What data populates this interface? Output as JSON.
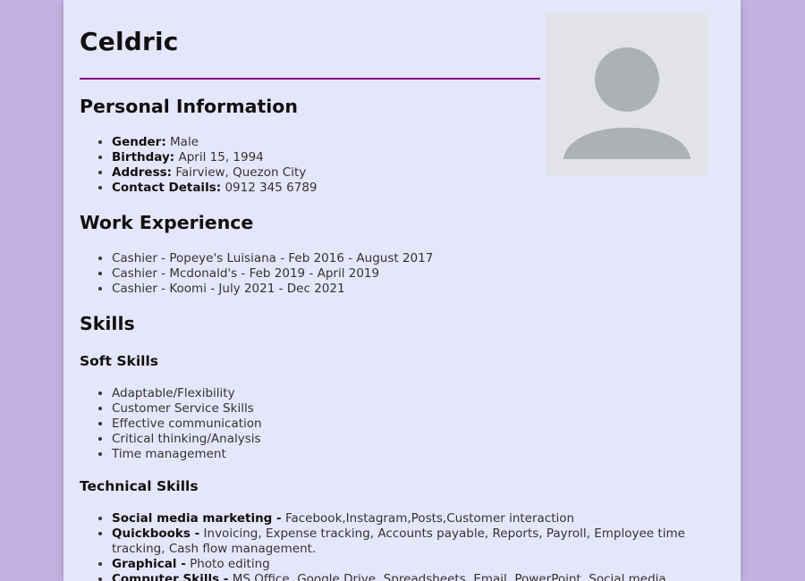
{
  "profile": {
    "name": "Celdric",
    "avatar_icon": "person-avatar-icon"
  },
  "personal": {
    "heading": "Personal Information",
    "items": [
      {
        "label": "Gender:",
        "value": "Male"
      },
      {
        "label": "Birthday:",
        "value": "April 15, 1994"
      },
      {
        "label": "Address:",
        "value": "Fairview, Quezon City"
      },
      {
        "label": "Contact Details:",
        "value": "0912 345 6789"
      }
    ]
  },
  "work": {
    "heading": "Work Experience",
    "items": [
      "Cashier - Popeye's Luisiana - Feb 2016 - August 2017",
      "Cashier - Mcdonald's - Feb 2019 - April 2019",
      "Cashier - Koomi - July 2021 - Dec 2021"
    ]
  },
  "skills": {
    "heading": "Skills",
    "soft": {
      "heading": "Soft Skills",
      "items": [
        "Adaptable/Flexibility",
        "Customer Service Skills",
        "Effective communication",
        "Critical thinking/Analysis",
        "Time management"
      ]
    },
    "technical": {
      "heading": "Technical Skills",
      "items": [
        {
          "label": "Social media marketing -",
          "value": "Facebook,Instagram,Posts,Customer interaction"
        },
        {
          "label": "Quickbooks -",
          "value": "Invoicing, Expense tracking, Accounts payable, Reports, Payroll, Employee time tracking, Cash flow management."
        },
        {
          "label": "Graphical -",
          "value": "Photo editing"
        },
        {
          "label": "Computer Skills -",
          "value": "MS Office, Google Drive, Spreadsheets, Email, PowerPoint, Social media"
        }
      ]
    }
  },
  "colors": {
    "page_background": "#c4b1e1",
    "sheet_background": "#e6e6fa",
    "divider": "#800080",
    "avatar_background": "#e2e3e7",
    "avatar_figure": "#adb1b5"
  }
}
